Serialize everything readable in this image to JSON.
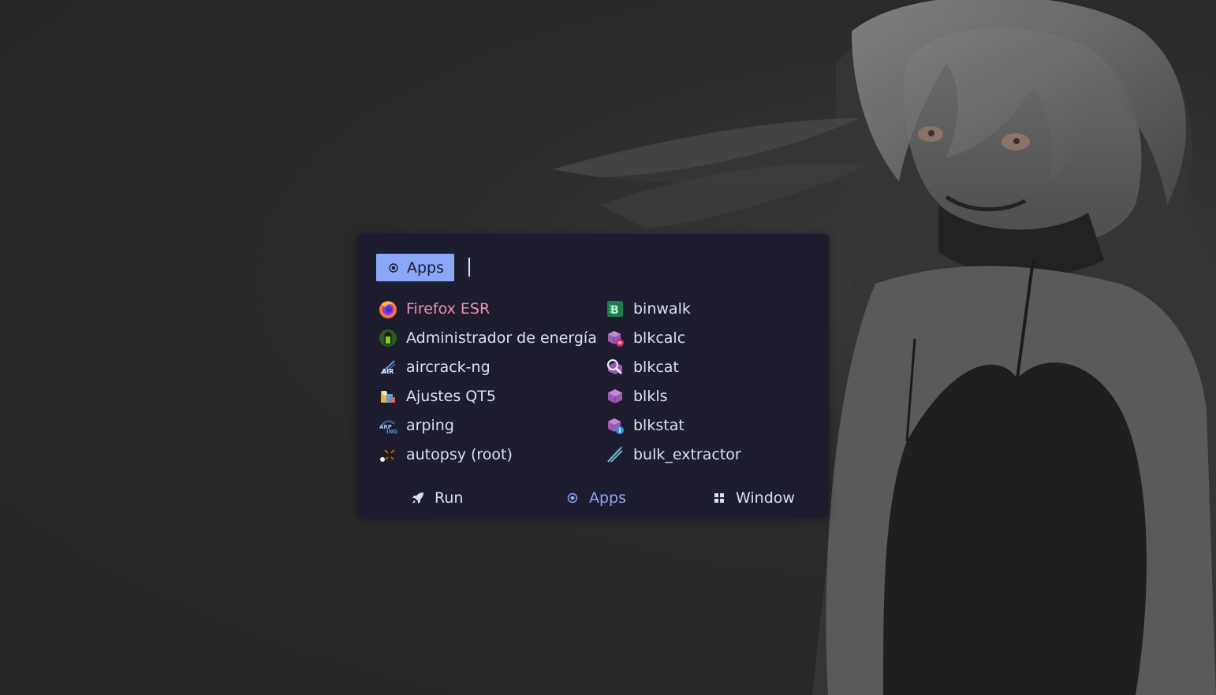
{
  "colors": {
    "launcher_bg": "#1e1d2f",
    "accent": "#8aa8f7",
    "selected_text": "#f28fad",
    "text": "#d9e0ee"
  },
  "mode_chip": {
    "icon": "apps-dot-icon",
    "label": "Apps"
  },
  "search": {
    "value": "",
    "placeholder": ""
  },
  "entries": [
    {
      "label": "Firefox ESR",
      "icon": "firefox-icon",
      "selected": true
    },
    {
      "label": "Administrador de energía",
      "icon": "battery-icon",
      "selected": false
    },
    {
      "label": "aircrack-ng",
      "icon": "aircrack-icon",
      "selected": false
    },
    {
      "label": "Ajustes QT5",
      "icon": "qt-settings-icon",
      "selected": false
    },
    {
      "label": "arping",
      "icon": "arping-icon",
      "selected": false
    },
    {
      "label": "autopsy (root)",
      "icon": "autopsy-icon",
      "selected": false
    },
    {
      "label": "binwalk",
      "icon": "binwalk-icon",
      "selected": false
    },
    {
      "label": "blkcalc",
      "icon": "sleuthkit-calc-icon",
      "selected": false
    },
    {
      "label": "blkcat",
      "icon": "sleuthkit-cat-icon",
      "selected": false
    },
    {
      "label": "blkls",
      "icon": "sleuthkit-icon",
      "selected": false
    },
    {
      "label": "blkstat",
      "icon": "sleuthkit-info-icon",
      "selected": false
    },
    {
      "label": "bulk_extractor",
      "icon": "bulk-extractor-icon",
      "selected": false
    }
  ],
  "modes": [
    {
      "label": "Run",
      "icon": "rocket-icon",
      "active": false
    },
    {
      "label": "Apps",
      "icon": "apps-dot-icon",
      "active": true
    },
    {
      "label": "Window",
      "icon": "window-grid-icon",
      "active": false
    }
  ]
}
